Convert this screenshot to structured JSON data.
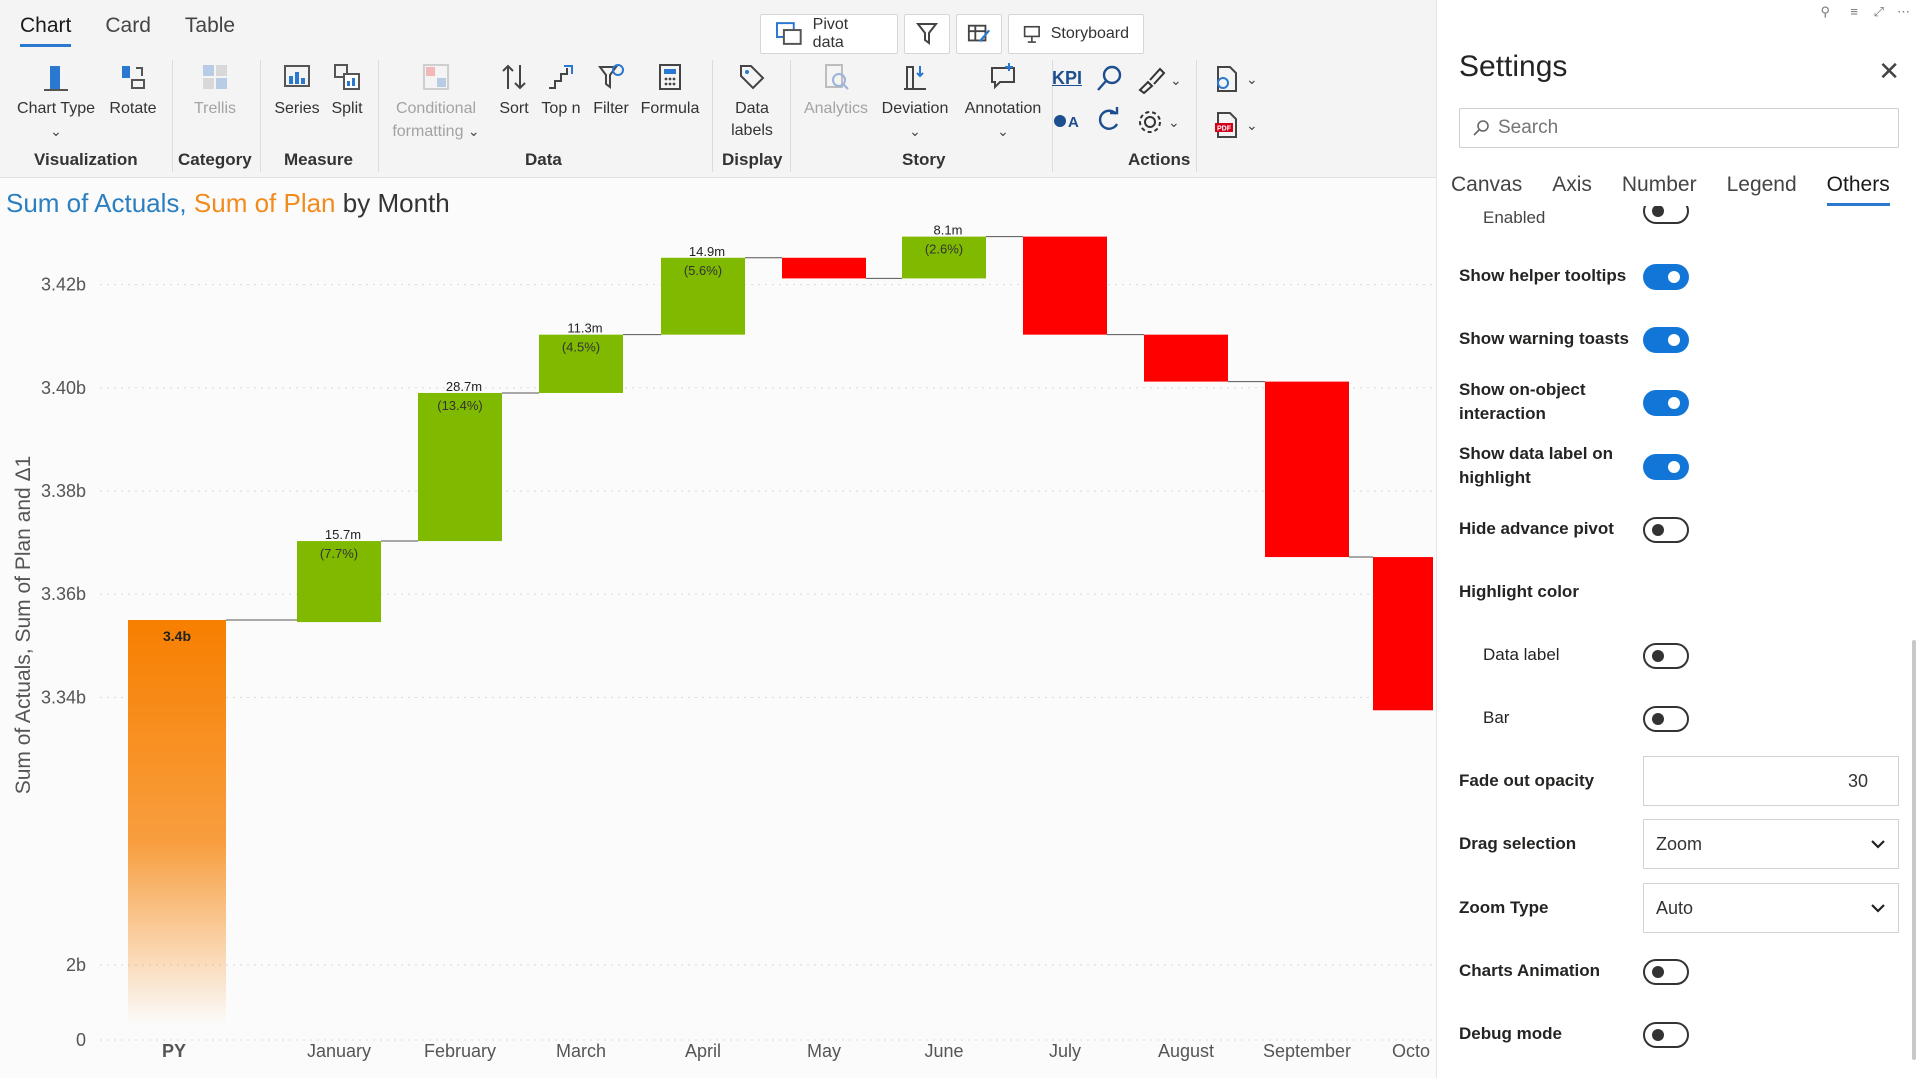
{
  "ribbon": {
    "tabs": [
      "Chart",
      "Card",
      "Table"
    ],
    "active_tab": "Chart",
    "top_buttons": {
      "pivot": "Pivot data",
      "storyboard": "Storyboard"
    },
    "tools": {
      "chart_type": "Chart Type",
      "rotate": "Rotate",
      "trellis": "Trellis",
      "series": "Series",
      "split": "Split",
      "conditional_1": "Conditional",
      "conditional_2": "formatting",
      "sort": "Sort",
      "top_n": "Top n",
      "filter": "Filter",
      "formula": "Formula",
      "data_labels_1": "Data",
      "data_labels_2": "labels",
      "analytics": "Analytics",
      "deviation": "Deviation",
      "annotation": "Annotation",
      "kpi": "KPI"
    },
    "groups": {
      "visualization": "Visualization",
      "category": "Category",
      "measure": "Measure",
      "data": "Data",
      "display": "Display",
      "story": "Story",
      "actions": "Actions"
    }
  },
  "chart": {
    "title_s1": "Sum of Actuals,",
    "title_s2": "Sum of Plan",
    "title_rest": "by Month"
  },
  "chart_data": {
    "type": "bar",
    "subtype": "waterfall",
    "title": "Sum of Actuals, Sum of Plan by Month",
    "ylabel": "Sum of Actuals, Sum of Plan and Δ1",
    "y_ticks": [
      "0",
      "2b",
      "3.34b",
      "3.36b",
      "3.38b",
      "3.40b",
      "3.42b"
    ],
    "y_axis_break": true,
    "categories": [
      "PY",
      "January",
      "February",
      "March",
      "April",
      "May",
      "June",
      "July",
      "August",
      "September",
      "Octo"
    ],
    "base": {
      "category": "PY",
      "value": 3.355,
      "label": "3.4b",
      "color": "#f77f00"
    },
    "deltas": [
      {
        "category": "January",
        "start": 3.3546,
        "end": 3.3703,
        "label": "15.7m",
        "pct": "(7.7%)"
      },
      {
        "category": "February",
        "start": 3.3703,
        "end": 3.399,
        "label": "28.7m",
        "pct": "(13.4%)"
      },
      {
        "category": "March",
        "start": 3.399,
        "end": 3.4103,
        "label": "11.3m",
        "pct": "(4.5%)"
      },
      {
        "category": "April",
        "start": 3.4103,
        "end": 3.4252,
        "label": "14.9m",
        "pct": "(5.6%)"
      },
      {
        "category": "May",
        "start": 3.4252,
        "end": 3.4212,
        "label": "",
        "pct": ""
      },
      {
        "category": "June",
        "start": 3.4212,
        "end": 3.4293,
        "label": "8.1m",
        "pct": "(2.6%)"
      },
      {
        "category": "July",
        "start": 3.4293,
        "end": 3.4103,
        "label": "",
        "pct": ""
      },
      {
        "category": "August",
        "start": 3.4103,
        "end": 3.4012,
        "label": "",
        "pct": ""
      },
      {
        "category": "September",
        "start": 3.4012,
        "end": 3.3672,
        "label": "",
        "pct": ""
      },
      {
        "category": "Octo",
        "start": 3.3672,
        "end": 3.3375,
        "label": "",
        "pct": ""
      }
    ],
    "colors": {
      "positive": "#7fba00",
      "negative": "#ff0000",
      "base": "#f77f00"
    },
    "grid": true
  },
  "settings": {
    "title": "Settings",
    "search_placeholder": "Search",
    "tabs": [
      "Canvas",
      "Axis",
      "Number",
      "Legend",
      "Others"
    ],
    "active_tab": "Others",
    "rows": {
      "enabled": "Enabled",
      "helper_tooltips": "Show helper tooltips",
      "warning_toasts": "Show warning toasts",
      "on_object_1": "Show on-object",
      "on_object_2": "interaction",
      "data_label_1": "Show data label on",
      "data_label_2": "highlight",
      "hide_pivot": "Hide advance pivot",
      "highlight_color": "Highlight color",
      "hl_data_label": "Data label",
      "hl_bar": "Bar",
      "fade_opacity": "Fade out opacity",
      "drag_selection": "Drag selection",
      "zoom_type": "Zoom Type",
      "charts_animation": "Charts Animation",
      "debug_mode": "Debug mode"
    },
    "values": {
      "fade_opacity": "30",
      "drag_selection": "Zoom",
      "zoom_type": "Auto"
    },
    "toggles": {
      "enabled": false,
      "helper_tooltips": true,
      "warning_toasts": true,
      "on_object": true,
      "data_label_highlight": true,
      "hide_pivot": false,
      "hl_data_label": false,
      "hl_bar": false,
      "charts_animation": false,
      "debug_mode": false
    }
  }
}
